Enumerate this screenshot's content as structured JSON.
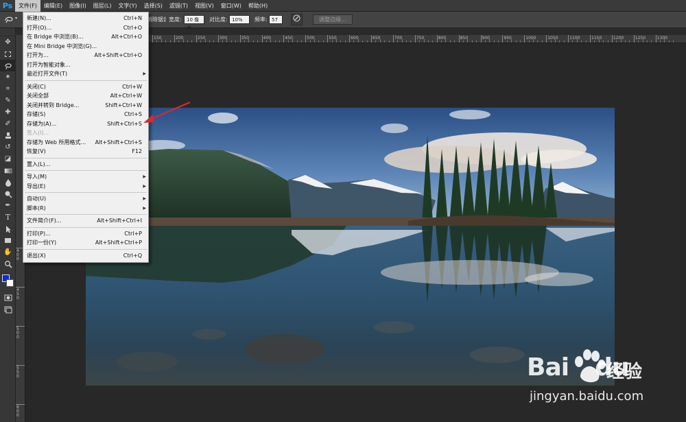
{
  "app": {
    "logo_text": "Ps"
  },
  "menubar": {
    "items": [
      {
        "label": "文件(F)",
        "active": true
      },
      {
        "label": "编辑(E)"
      },
      {
        "label": "图像(I)"
      },
      {
        "label": "图层(L)"
      },
      {
        "label": "文字(Y)"
      },
      {
        "label": "选择(S)"
      },
      {
        "label": "滤镜(T)"
      },
      {
        "label": "视图(V)"
      },
      {
        "label": "窗口(W)"
      },
      {
        "label": "帮助(H)"
      }
    ]
  },
  "options_bar": {
    "partial_label": "消除锯齿",
    "width_label": "宽度:",
    "width_value": "10 像素",
    "contrast_label": "对比度:",
    "contrast_value": "10%",
    "frequency_label": "频率:",
    "frequency_value": "57",
    "refine_edge_button": "调整边缘..."
  },
  "file_menu": {
    "items": [
      {
        "label": "新建(N)...",
        "shortcut": "Ctrl+N"
      },
      {
        "label": "打开(O)...",
        "shortcut": "Ctrl+O"
      },
      {
        "label": "在 Bridge 中浏览(B)...",
        "shortcut": "Alt+Ctrl+O"
      },
      {
        "label": "在 Mini Bridge 中浏览(G)...",
        "shortcut": ""
      },
      {
        "label": "打开为...",
        "shortcut": "Alt+Shift+Ctrl+O"
      },
      {
        "label": "打开为智能对象...",
        "shortcut": ""
      },
      {
        "label": "最近打开文件(T)",
        "shortcut": "",
        "submenu": true
      },
      {
        "separator": true
      },
      {
        "label": "关闭(C)",
        "shortcut": "Ctrl+W"
      },
      {
        "label": "关闭全部",
        "shortcut": "Alt+Ctrl+W"
      },
      {
        "label": "关闭并转到 Bridge...",
        "shortcut": "Shift+Ctrl+W"
      },
      {
        "label": "存储(S)",
        "shortcut": "Ctrl+S"
      },
      {
        "label": "存储为(A)...",
        "shortcut": "Shift+Ctrl+S"
      },
      {
        "label": "签入(I)...",
        "shortcut": "",
        "disabled": true
      },
      {
        "label": "存储为 Web 所用格式...",
        "shortcut": "Alt+Shift+Ctrl+S"
      },
      {
        "label": "恢复(V)",
        "shortcut": "F12"
      },
      {
        "separator": true
      },
      {
        "label": "置入(L)...",
        "shortcut": ""
      },
      {
        "separator": true
      },
      {
        "label": "导入(M)",
        "shortcut": "",
        "submenu": true
      },
      {
        "label": "导出(E)",
        "shortcut": "",
        "submenu": true
      },
      {
        "separator": true
      },
      {
        "label": "自动(U)",
        "shortcut": "",
        "submenu": true
      },
      {
        "label": "脚本(R)",
        "shortcut": "",
        "submenu": true
      },
      {
        "separator": true
      },
      {
        "label": "文件简介(F)...",
        "shortcut": "Alt+Shift+Ctrl+I"
      },
      {
        "separator": true
      },
      {
        "label": "打印(P)...",
        "shortcut": "Ctrl+P"
      },
      {
        "label": "打印一份(Y)",
        "shortcut": "Alt+Shift+Ctrl+P"
      },
      {
        "separator": true
      },
      {
        "label": "退出(X)",
        "shortcut": "Ctrl+Q"
      }
    ]
  },
  "ruler": {
    "h_ticks": [
      "150",
      "200",
      "250",
      "300",
      "350",
      "400",
      "450",
      "500",
      "550",
      "600",
      "650",
      "700",
      "750",
      "800",
      "850",
      "900",
      "950",
      "1000",
      "1050",
      "1100",
      "1150",
      "1200",
      "1250",
      "1300"
    ],
    "v_ticks": [
      "4\n0\n0",
      "4\n5\n0",
      "5\n0\n0",
      "5\n5\n0",
      "6\n0\n0"
    ]
  },
  "tools": [
    {
      "name": "move-tool-icon",
      "glyph": "✥"
    },
    {
      "name": "marquee-tool-icon",
      "glyph": "⬚"
    },
    {
      "name": "lasso-tool-icon",
      "glyph": "➰",
      "selected": true
    },
    {
      "name": "magic-wand-tool-icon",
      "glyph": "✶"
    },
    {
      "name": "crop-tool-icon",
      "glyph": "⌗"
    },
    {
      "name": "eyedropper-tool-icon",
      "glyph": "✎"
    },
    {
      "name": "healing-brush-tool-icon",
      "glyph": "✚"
    },
    {
      "name": "brush-tool-icon",
      "glyph": "✐"
    },
    {
      "name": "clone-stamp-tool-icon",
      "glyph": "⚲"
    },
    {
      "name": "history-brush-tool-icon",
      "glyph": "↺"
    },
    {
      "name": "eraser-tool-icon",
      "glyph": "◪"
    },
    {
      "name": "gradient-tool-icon",
      "glyph": "▥"
    },
    {
      "name": "blur-tool-icon",
      "glyph": "💧"
    },
    {
      "name": "dodge-tool-icon",
      "glyph": "●"
    },
    {
      "name": "pen-tool-icon",
      "glyph": "✒"
    },
    {
      "name": "type-tool-icon",
      "glyph": "T"
    },
    {
      "name": "path-selection-tool-icon",
      "glyph": "➤"
    },
    {
      "name": "shape-tool-icon",
      "glyph": "■"
    },
    {
      "name": "hand-tool-icon",
      "glyph": "✋"
    },
    {
      "name": "zoom-tool-icon",
      "glyph": "⚲"
    }
  ],
  "colors": {
    "foreground": "#0d2bd6",
    "background": "#ffffff",
    "annotation_arrow": "#e0262b"
  },
  "watermark": {
    "logo_left": "Bai",
    "logo_right": "du",
    "cn_text": "经验",
    "url": "jingyan.baidu.com"
  }
}
